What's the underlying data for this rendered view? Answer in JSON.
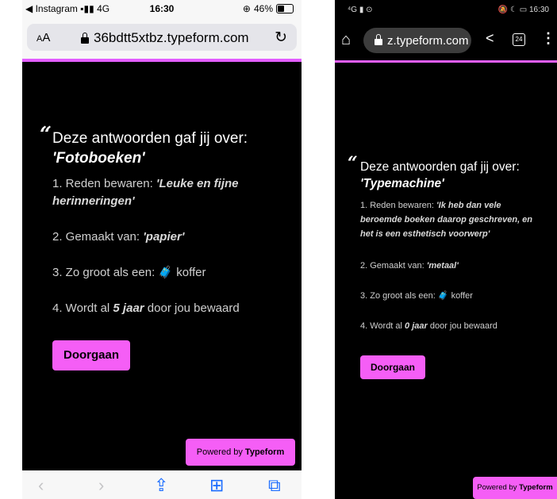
{
  "ios": {
    "status": {
      "carrier": "◀ Instagram",
      "network": "4G",
      "time": "16:30",
      "alarm_icon": "alarm-icon",
      "battery": "46%",
      "battery_level": 0.46
    },
    "browser": {
      "text_size": "AA",
      "url": "36bdtt5xtbz.typeform.com"
    },
    "content": {
      "quote": "“",
      "heading_prefix": "Deze antwoorden gaf jij over:",
      "heading_item": "'Fotoboeken'",
      "items": [
        {
          "prefix": "1. Reden bewaren: ",
          "value": "'Leuke en fijne herinneringen'",
          "suffix": ""
        },
        {
          "prefix": "2. Gemaakt van: ",
          "value": "'papier'",
          "suffix": ""
        },
        {
          "prefix": "3. Zo groot als een: ",
          "emoji": "🧳",
          "suffix": " koffer"
        },
        {
          "prefix": "4. Wordt al ",
          "value": "5 jaar",
          "suffix": " door jou bewaard"
        }
      ],
      "button": "Doorgaan"
    },
    "powered_prefix": "Powered by ",
    "powered_brand": "Typeform"
  },
  "android": {
    "status": {
      "left": "⁴G ▮ ⊙",
      "right": "🔕 ☾ ▭ 16:30"
    },
    "browser": {
      "url": "z.typeform.com",
      "tab_count": "24"
    },
    "content": {
      "quote": "“",
      "heading_prefix": "Deze antwoorden gaf jij over:",
      "heading_item": "'Typemachine'",
      "items": [
        {
          "prefix": "1. Reden bewaren: ",
          "value": "'Ik heb dan vele beroemde boeken daarop geschreven, en het is een esthetisch voorwerp'",
          "suffix": ""
        },
        {
          "prefix": "2. Gemaakt van: ",
          "value": "'metaal'",
          "suffix": ""
        },
        {
          "prefix": "3. Zo groot als een: ",
          "emoji": "🧳",
          "suffix": " koffer"
        },
        {
          "prefix": "4. Wordt al ",
          "value": "0 jaar",
          "suffix": " door jou bewaard"
        }
      ],
      "button": "Doorgaan"
    },
    "powered_prefix": "Powered by ",
    "powered_brand": "Typeform"
  },
  "colors": {
    "accent": "#e35eff",
    "button": "#f55ef6",
    "background": "#000000"
  }
}
